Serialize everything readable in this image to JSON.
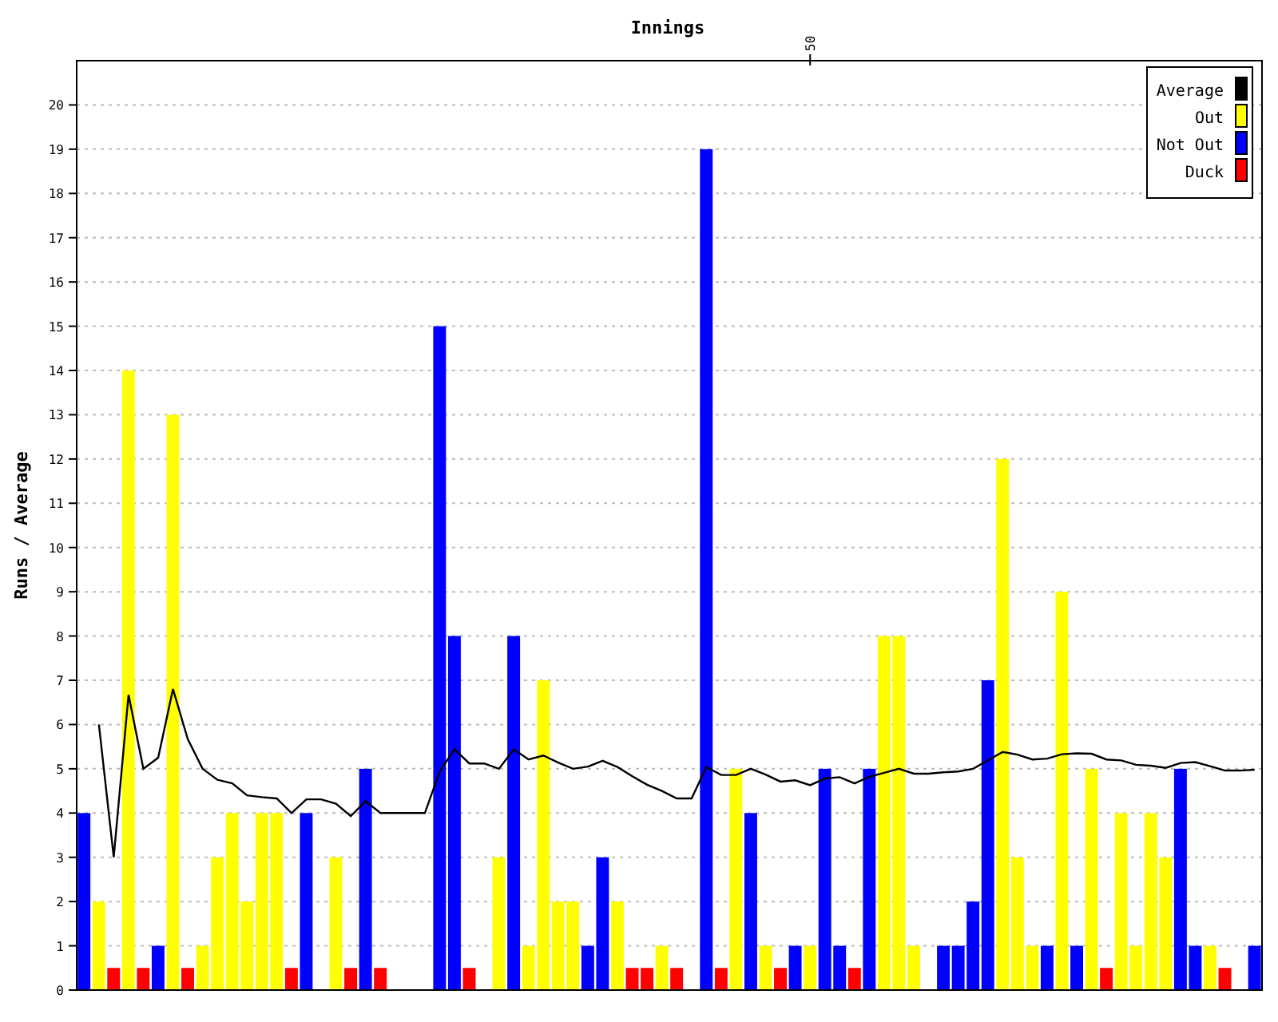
{
  "chart_data": {
    "type": "bar",
    "title": "Innings",
    "ylabel": "Runs / Average",
    "ylim": [
      0,
      21
    ],
    "grid": true,
    "legend": true,
    "annotations": [
      "50"
    ],
    "yticks": [
      {
        "value": 0,
        "label": "0"
      },
      {
        "value": 1,
        "label": "1"
      },
      {
        "value": 2,
        "label": "2"
      },
      {
        "value": 3,
        "label": "3"
      },
      {
        "value": 4,
        "label": "4"
      },
      {
        "value": 5,
        "label": "5"
      },
      {
        "value": 6,
        "label": "6"
      },
      {
        "value": 7,
        "label": "7"
      },
      {
        "value": 8,
        "label": "8"
      },
      {
        "value": 9,
        "label": "9"
      },
      {
        "value": 10,
        "label": "10"
      },
      {
        "value": 11,
        "label": "11"
      },
      {
        "value": 12,
        "label": "12"
      },
      {
        "value": 13,
        "label": "13"
      },
      {
        "value": 14,
        "label": "14"
      },
      {
        "value": 15,
        "label": "15"
      },
      {
        "value": 16,
        "label": "16"
      },
      {
        "value": 17,
        "label": "17"
      },
      {
        "value": 18,
        "label": "18"
      },
      {
        "value": 19,
        "label": "19"
      },
      {
        "value": 20,
        "label": "20"
      }
    ],
    "series": [
      {
        "name": "Average",
        "type": "line",
        "color": "#000000",
        "values": [
          null,
          6,
          3,
          6.67,
          5,
          5.25,
          6.8,
          5.67,
          5,
          4.75,
          4.67,
          4.4,
          4.36,
          4.33,
          4,
          4.31,
          4.31,
          4.21,
          3.93,
          4.27,
          4,
          4,
          4,
          4,
          4.94,
          5.44,
          5.12,
          5.12,
          5,
          5.44,
          5.21,
          5.3,
          5.14,
          5,
          5.05,
          5.18,
          5.04,
          4.83,
          4.64,
          4.5,
          4.33,
          4.33,
          5.04,
          4.86,
          4.86,
          5,
          4.87,
          4.71,
          4.74,
          4.63,
          4.78,
          4.81,
          4.67,
          4.82,
          4.91,
          5,
          4.89,
          4.89,
          4.92,
          4.94,
          5,
          5.19,
          5.38,
          5.32,
          5.21,
          5.23,
          5.33,
          5.35,
          5.34,
          5.21,
          5.19,
          5.09,
          5.07,
          5.02,
          5.13,
          5.15,
          5.06,
          4.96,
          4.96,
          4.98
        ]
      },
      {
        "name": "Out",
        "color": "#ffff00",
        "values": [
          null,
          2,
          null,
          14,
          null,
          null,
          13,
          null,
          1,
          3,
          4,
          2,
          4,
          4,
          null,
          null,
          null,
          3,
          null,
          null,
          null,
          null,
          null,
          null,
          null,
          null,
          null,
          null,
          3,
          null,
          1,
          7,
          2,
          2,
          null,
          null,
          2,
          null,
          null,
          1,
          null,
          null,
          null,
          null,
          5,
          null,
          1,
          null,
          null,
          1,
          null,
          null,
          null,
          null,
          8,
          8,
          1,
          null,
          null,
          null,
          null,
          null,
          12,
          3,
          1,
          null,
          9,
          null,
          5,
          null,
          4,
          1,
          4,
          3,
          null,
          null,
          1,
          null,
          null,
          null
        ]
      },
      {
        "name": "Not Out",
        "color": "#0000ff",
        "values": [
          4,
          null,
          null,
          null,
          null,
          1,
          null,
          null,
          null,
          null,
          null,
          null,
          null,
          null,
          null,
          4,
          null,
          null,
          null,
          5,
          null,
          null,
          null,
          null,
          15,
          8,
          null,
          null,
          null,
          8,
          null,
          null,
          null,
          null,
          1,
          3,
          null,
          null,
          null,
          null,
          null,
          null,
          19,
          null,
          null,
          4,
          null,
          null,
          1,
          null,
          5,
          1,
          null,
          5,
          null,
          null,
          null,
          null,
          1,
          1,
          2,
          7,
          null,
          null,
          null,
          1,
          null,
          1,
          null,
          null,
          null,
          null,
          null,
          null,
          5,
          1,
          null,
          null,
          null,
          1
        ]
      },
      {
        "name": "Duck",
        "color": "#ff0000",
        "values": [
          null,
          null,
          0.5,
          null,
          0.5,
          null,
          null,
          0.5,
          null,
          null,
          null,
          null,
          null,
          null,
          0.5,
          null,
          null,
          null,
          0.5,
          null,
          0.5,
          null,
          null,
          null,
          null,
          null,
          0.5,
          null,
          null,
          null,
          null,
          null,
          null,
          null,
          null,
          null,
          null,
          0.5,
          0.5,
          null,
          0.5,
          null,
          null,
          0.5,
          null,
          null,
          null,
          0.5,
          null,
          null,
          null,
          null,
          0.5,
          null,
          null,
          null,
          null,
          null,
          null,
          null,
          null,
          null,
          null,
          null,
          null,
          null,
          null,
          null,
          null,
          0.5,
          null,
          null,
          null,
          null,
          null,
          null,
          null,
          0.5,
          null,
          null
        ]
      }
    ]
  }
}
